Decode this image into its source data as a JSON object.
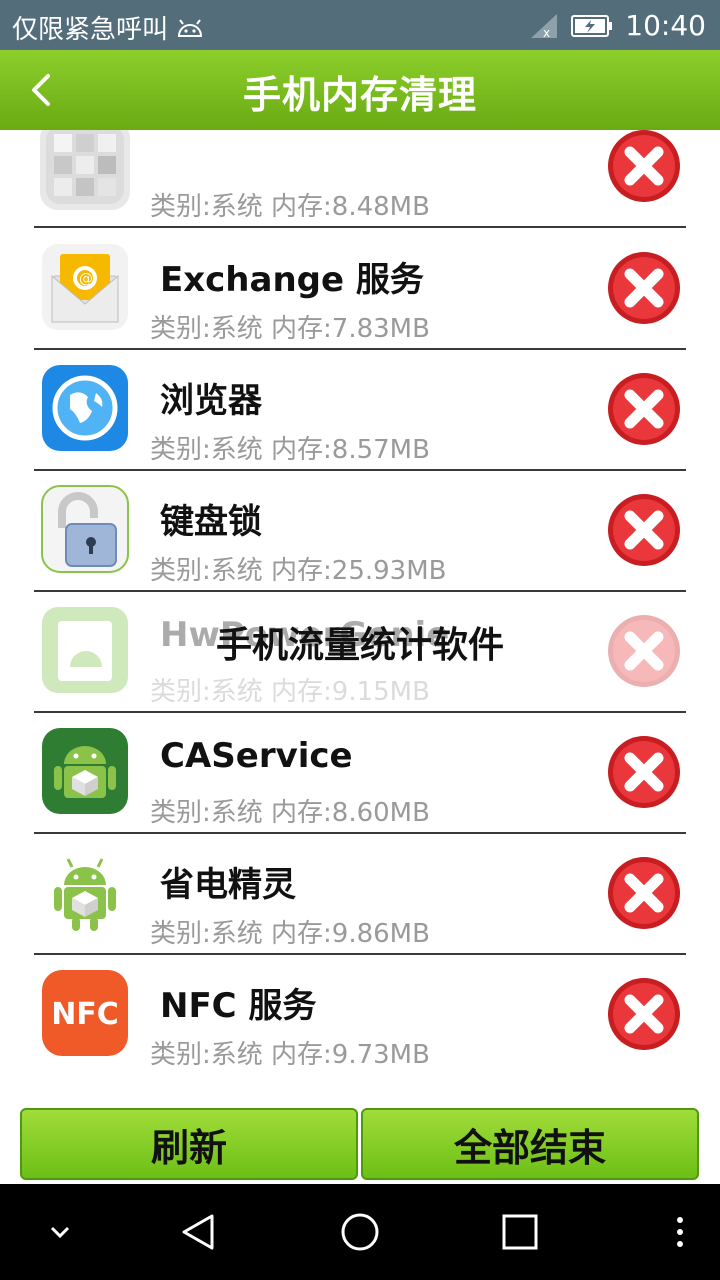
{
  "status_bar": {
    "carrier": "仅限紧急呼叫",
    "time": "10:40",
    "icons": [
      "android-icon",
      "signal-icon",
      "battery-icon"
    ]
  },
  "header": {
    "title": "手机内存清理",
    "back_icon": "back-arrow-icon"
  },
  "apps": [
    {
      "name": "",
      "category": "类别:系统",
      "memory": "内存:8.48MB",
      "icon": "cube-grid-icon"
    },
    {
      "name": "Exchange 服务",
      "category": "类别:系统",
      "memory": "内存:7.83MB",
      "icon": "email-icon"
    },
    {
      "name": "浏览器",
      "category": "类别:系统",
      "memory": "内存:8.57MB",
      "icon": "globe-icon"
    },
    {
      "name": "键盘锁",
      "category": "类别:系统",
      "memory": "内存:25.93MB",
      "icon": "padlock-icon"
    },
    {
      "name": "HwPowerGenie",
      "category": "类别:系统",
      "memory": "内存:9.15MB",
      "icon": "android-app-icon"
    },
    {
      "name": "CAService",
      "category": "类别:系统",
      "memory": "内存:8.60MB",
      "icon": "android-box-icon"
    },
    {
      "name": "省电精灵",
      "category": "类别:系统",
      "memory": "内存:9.86MB",
      "icon": "android-box-icon"
    },
    {
      "name": "NFC 服务",
      "category": "类别:系统",
      "memory": "内存:9.73MB",
      "icon": "nfc-icon"
    }
  ],
  "overlay_text": "手机流量统计软件",
  "buttons": {
    "refresh": "刷新",
    "end_all": "全部结束"
  },
  "nav": [
    "hide-keyboard-icon",
    "back-icon",
    "home-icon",
    "recents-icon",
    "more-icon"
  ],
  "colors": {
    "header_green": "#7cc021",
    "status_bar": "#536d7b",
    "kill_red": "#e0262a"
  }
}
